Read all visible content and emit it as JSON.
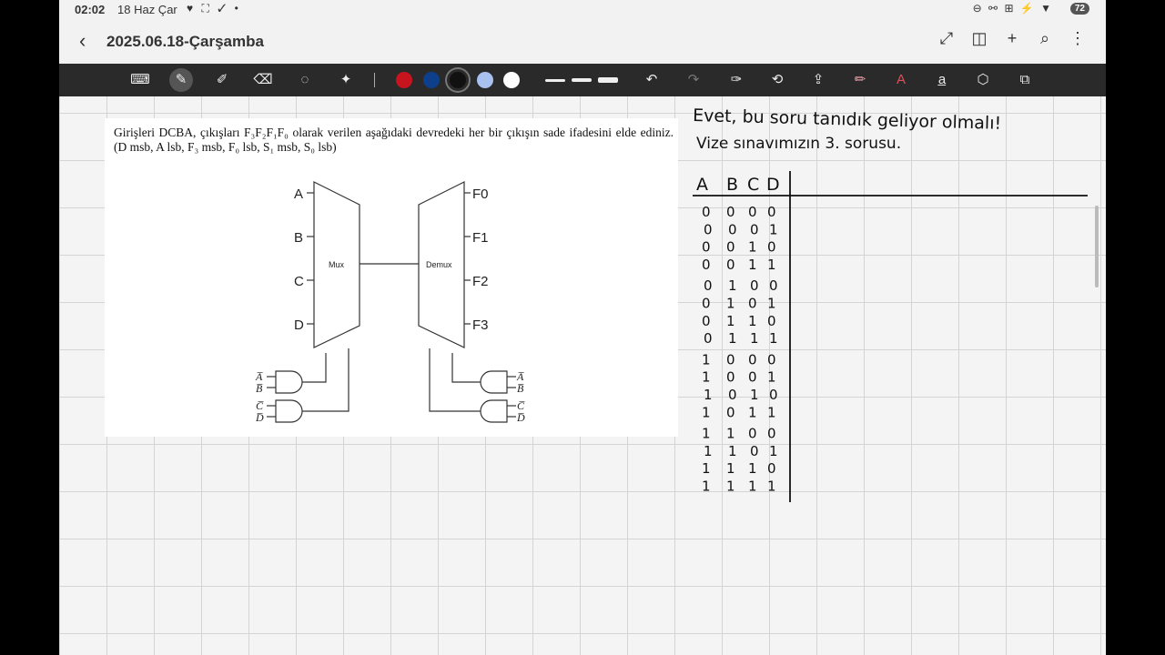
{
  "status": {
    "time": "02:02",
    "date": "18 Haz Çar",
    "left_icons": "♥ ⛶ ✓ •",
    "right_icons": "⊖ ⚯ ⊞ ⚡ ▼",
    "battery": "72"
  },
  "header": {
    "title": "2025.06.18-Çarşamba"
  },
  "icons": {
    "back": "‹",
    "expand": "⤢",
    "book": "◫",
    "add": "+",
    "search": "⌕",
    "more": "⋮",
    "keyboard": "⌨",
    "pen": "✎",
    "highlighter": "✐",
    "eraser": "⌫",
    "lasso": "◌",
    "magic": "✦",
    "undo": "↶",
    "redo": "↷",
    "t1": "✑",
    "t2": "⟲",
    "t3": "⇪",
    "t4": "✏",
    "t5": "A",
    "t6": "a̲",
    "t7": "⬡",
    "t8": "⧉"
  },
  "colors": {
    "c1": "#c8141e",
    "c2": "#0d3f8a",
    "c3": "#111111",
    "c4": "#a9c1f0",
    "c5": "#ffffff"
  },
  "question": {
    "text": "Girişleri DCBA, çıkışları F₃F₂F₁F₀ olarak verilen aşağıdaki devredeki her bir çıkışın sade ifadesini elde ediniz. (D msb, A lsb, F₃ msb, F₀ lsb, S₁ msb, S₀ lsb)",
    "inputs": [
      "A",
      "B",
      "C",
      "D"
    ],
    "outputs": [
      "F0",
      "F1",
      "F2",
      "F3"
    ],
    "mux_label": "Mux",
    "demux_label": "Demux",
    "and_left": [
      [
        "A̅",
        "B̅"
      ],
      [
        "C̅",
        "D̅"
      ]
    ],
    "and_right": [
      [
        "A̅",
        "B̅"
      ],
      [
        "C̅",
        "D̅"
      ]
    ]
  },
  "notes": {
    "line1": "Evet, bu soru tanıdık geliyor olmalı!",
    "line2": "Vize sınavımızın 3. sorusu.",
    "headers": [
      "A",
      "B",
      "C",
      "D"
    ],
    "rows": [
      [
        "0",
        "0",
        "0",
        "0"
      ],
      [
        "0",
        "0",
        "0",
        "1"
      ],
      [
        "0",
        "0",
        "1",
        "0"
      ],
      [
        "0",
        "0",
        "1",
        "1"
      ],
      [
        "0",
        "1",
        "0",
        "0"
      ],
      [
        "0",
        "1",
        "0",
        "1"
      ],
      [
        "0",
        "1",
        "1",
        "0"
      ],
      [
        "0",
        "1",
        "1",
        "1"
      ],
      [
        "1",
        "0",
        "0",
        "0"
      ],
      [
        "1",
        "0",
        "0",
        "1"
      ],
      [
        "1",
        "0",
        "1",
        "0"
      ],
      [
        "1",
        "0",
        "1",
        "1"
      ],
      [
        "1",
        "1",
        "0",
        "0"
      ],
      [
        "1",
        "1",
        "0",
        "1"
      ],
      [
        "1",
        "1",
        "1",
        "0"
      ],
      [
        "1",
        "1",
        "1",
        "1"
      ]
    ]
  }
}
